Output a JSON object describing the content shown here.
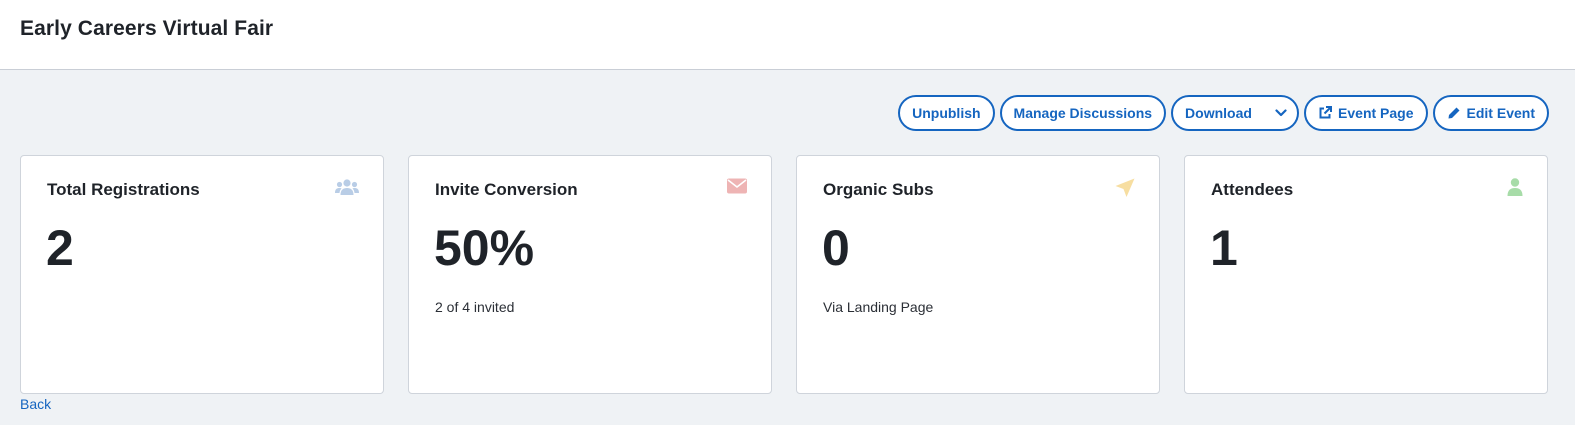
{
  "header": {
    "title": "Early Careers Virtual Fair"
  },
  "toolbar": {
    "unpublish_label": "Unpublish",
    "manage_discussions_label": "Manage Discussions",
    "download_label": "Download",
    "event_page_label": "Event Page",
    "edit_event_label": "Edit Event"
  },
  "cards": [
    {
      "title": "Total Registrations",
      "value": "2",
      "subtext": "",
      "icon": "users-icon",
      "icon_color": "#b9cde6"
    },
    {
      "title": "Invite Conversion",
      "value": "50%",
      "subtext": "2 of 4 invited",
      "icon": "envelope-icon",
      "icon_color": "#eeb4b4"
    },
    {
      "title": "Organic Subs",
      "value": "0",
      "subtext": "Via Landing Page",
      "icon": "paper-plane-icon",
      "icon_color": "#f7dea1"
    },
    {
      "title": "Attendees",
      "value": "1",
      "subtext": "",
      "icon": "user-icon",
      "icon_color": "#a7dca8"
    }
  ],
  "footer": {
    "back_label": "Back"
  },
  "colors": {
    "accent": "#1565c0",
    "background": "#eff2f5"
  }
}
